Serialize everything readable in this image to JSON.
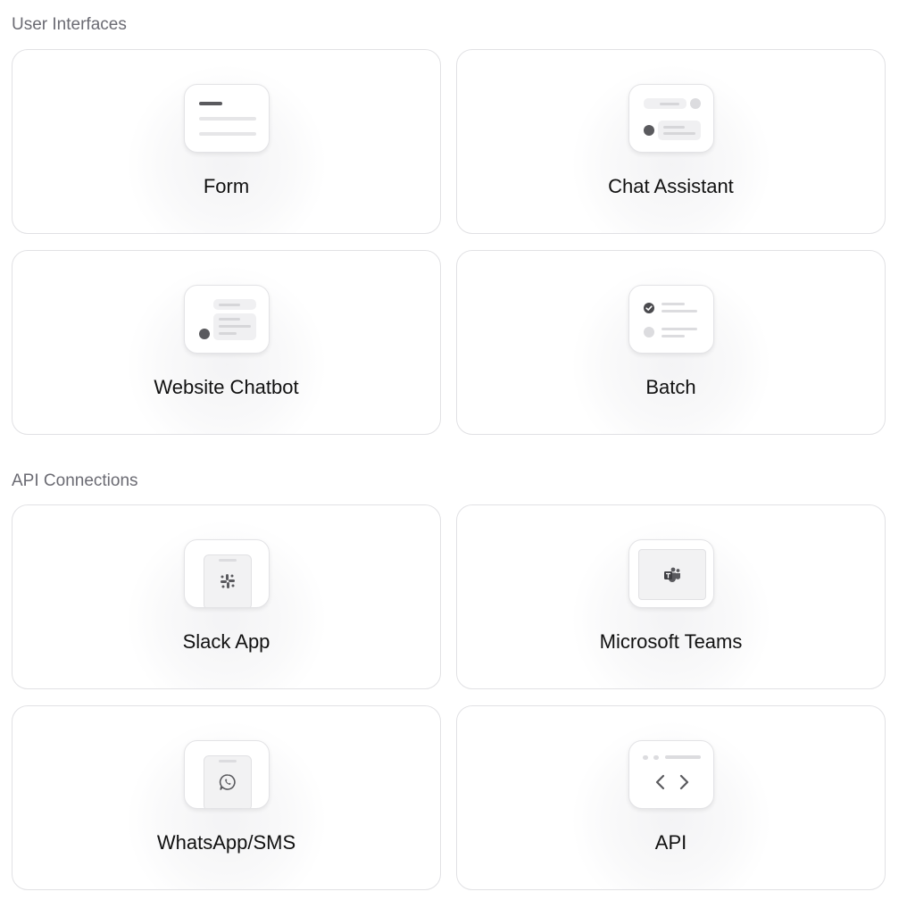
{
  "sections": [
    {
      "title": "User Interfaces",
      "cards": [
        {
          "label": "Form",
          "icon": "form-icon"
        },
        {
          "label": "Chat Assistant",
          "icon": "chat-assistant-icon"
        },
        {
          "label": "Website Chatbot",
          "icon": "website-chatbot-icon"
        },
        {
          "label": "Batch",
          "icon": "batch-icon"
        }
      ]
    },
    {
      "title": "API Connections",
      "cards": [
        {
          "label": "Slack App",
          "icon": "slack-icon"
        },
        {
          "label": "Microsoft Teams",
          "icon": "microsoft-teams-icon"
        },
        {
          "label": "WhatsApp/SMS",
          "icon": "whatsapp-icon"
        },
        {
          "label": "API",
          "icon": "code-brackets-icon"
        }
      ]
    }
  ],
  "colors": {
    "card_border": "#e1e1e4",
    "section_title": "#6b6b73",
    "icon_dark": "#5a5a5e",
    "icon_light": "#e6e6e8"
  }
}
